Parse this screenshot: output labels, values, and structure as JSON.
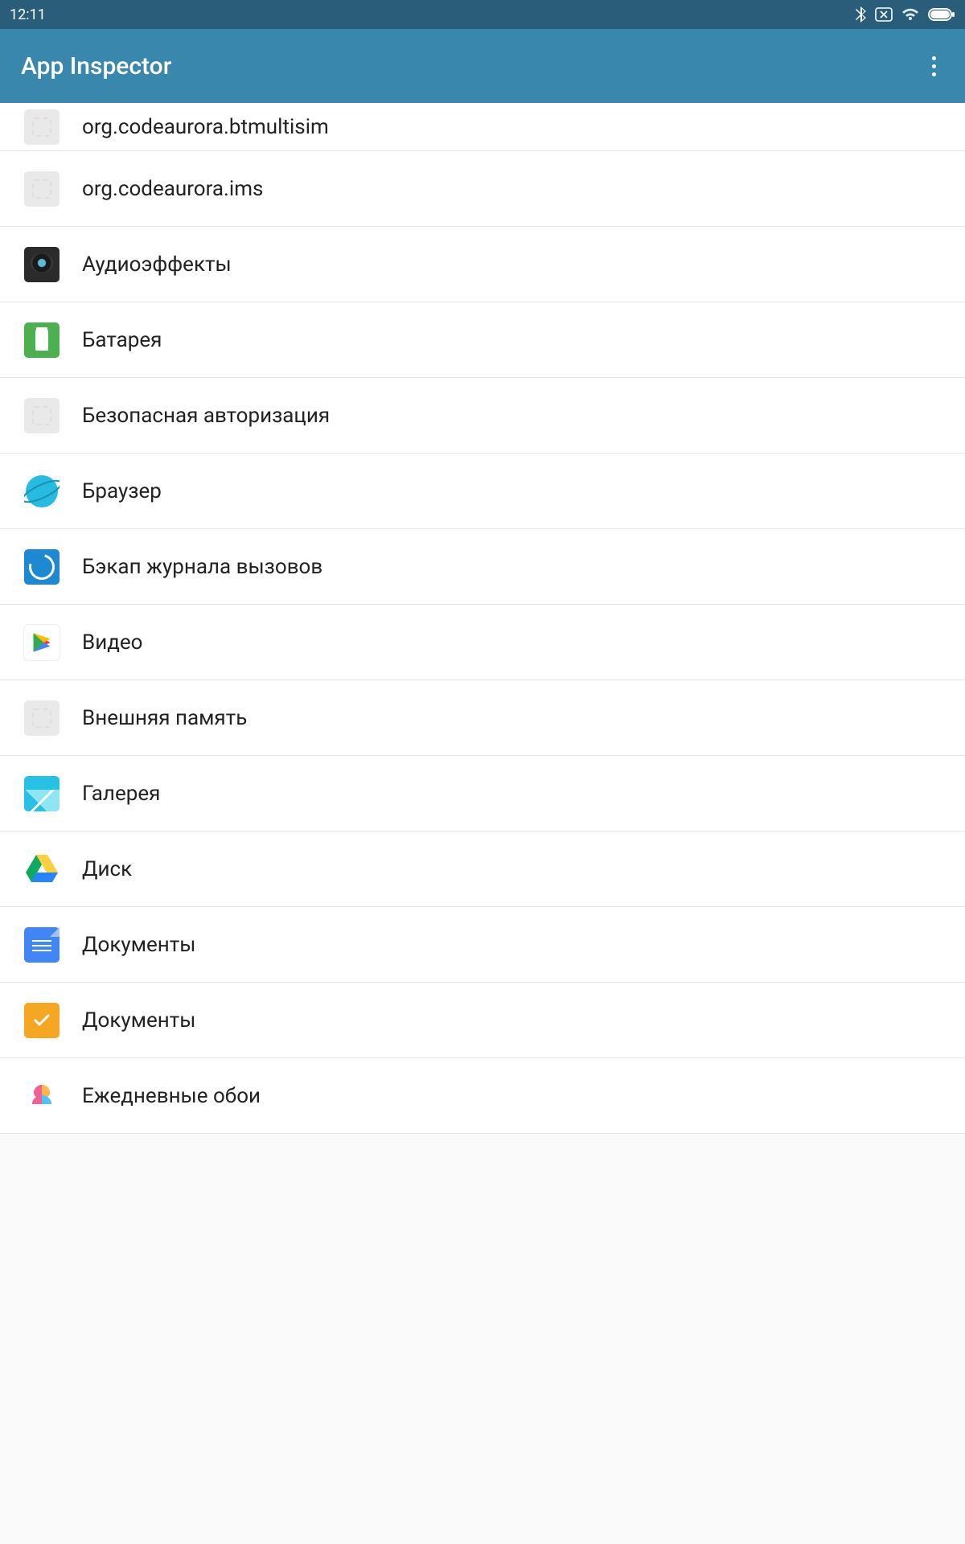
{
  "statusbar": {
    "time": "12:11"
  },
  "appbar": {
    "title": "App Inspector"
  },
  "apps": [
    {
      "label": "org.codeaurora.btmultisim",
      "icon": "generic"
    },
    {
      "label": "org.codeaurora.ims",
      "icon": "generic"
    },
    {
      "label": "Аудиоэффекты",
      "icon": "audio"
    },
    {
      "label": "Батарея",
      "icon": "battery"
    },
    {
      "label": "Безопасная авторизация",
      "icon": "generic"
    },
    {
      "label": "Браузер",
      "icon": "browser"
    },
    {
      "label": "Бэкап журнала вызовов",
      "icon": "backup"
    },
    {
      "label": "Видео",
      "icon": "play"
    },
    {
      "label": "Внешняя память",
      "icon": "generic"
    },
    {
      "label": "Галерея",
      "icon": "gallery"
    },
    {
      "label": "Диск",
      "icon": "drive"
    },
    {
      "label": "Документы",
      "icon": "docs"
    },
    {
      "label": "Документы",
      "icon": "docs2"
    },
    {
      "label": "Ежедневные обои",
      "icon": "wallpaper"
    }
  ]
}
